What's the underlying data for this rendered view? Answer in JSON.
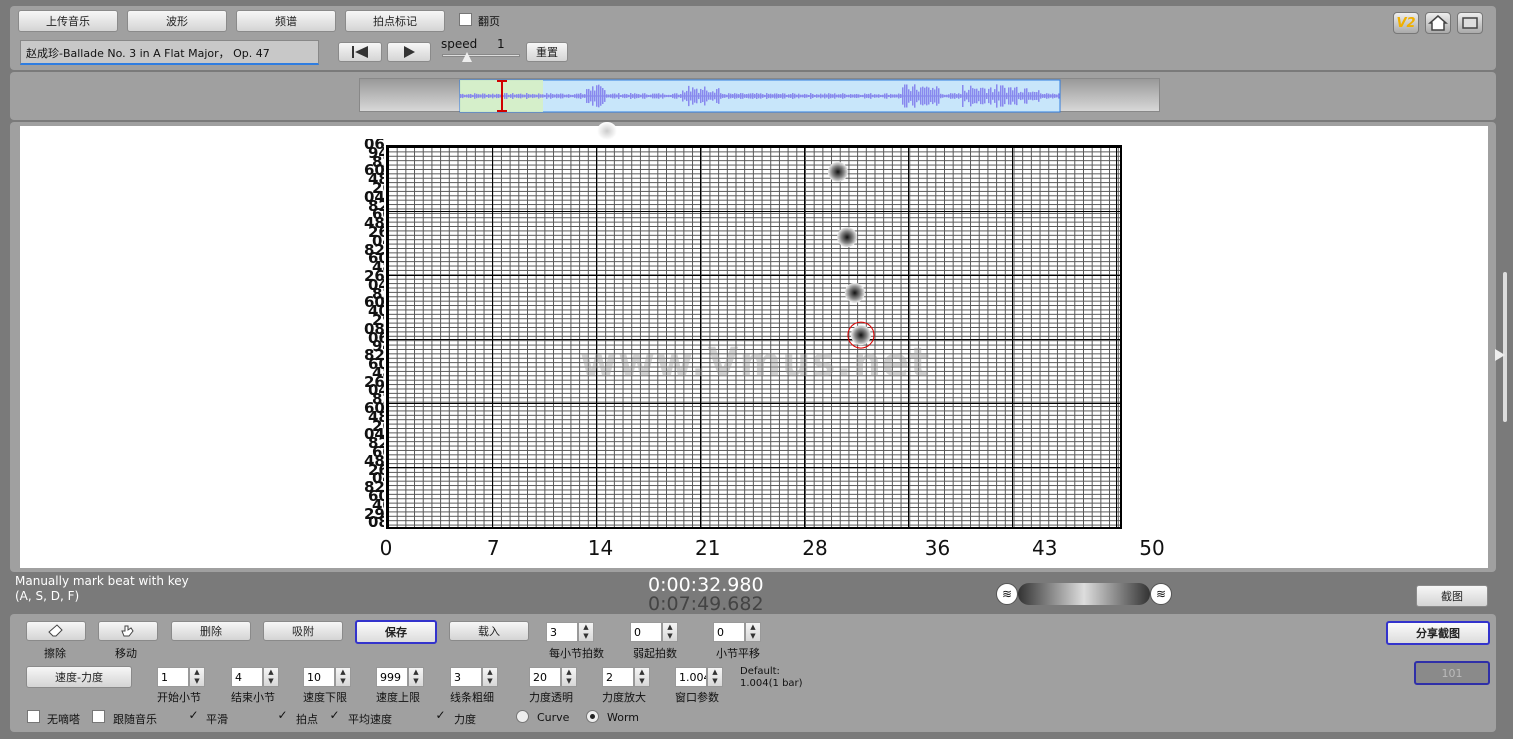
{
  "toolbar": {
    "upload_label": "上传音乐",
    "waveform_label": "波形",
    "spectrum_label": "频谱",
    "beat_mark_label": "拍点标记",
    "flip_page_label": "翻页"
  },
  "song": {
    "title": "赵成珍-Ballade No. 3 in A Flat Major， Op. 47"
  },
  "playback": {
    "speed_label": "speed",
    "speed_value": "1",
    "reset_label": "重置"
  },
  "top_right": {
    "v2_label": "V2"
  },
  "chart": {
    "x_ticks": [
      "0",
      "7",
      "14",
      "21",
      "28",
      "36",
      "43",
      "50"
    ],
    "watermark": "www.Vmus.net"
  },
  "chart_data": {
    "type": "scatter",
    "x_ticks": [
      0,
      7,
      14,
      21,
      28,
      36,
      43,
      50
    ],
    "xlim": [
      0,
      50
    ],
    "points": [
      {
        "x": 29.5,
        "y_frac": 0.93
      },
      {
        "x": 30.1,
        "y_frac": 0.76
      },
      {
        "x": 30.6,
        "y_frac": 0.615
      },
      {
        "x": 31.0,
        "y_frac": 0.505,
        "highlighted": true
      }
    ],
    "grid": true
  },
  "status": {
    "hint_line1": "Manually mark beat with key",
    "hint_line2": "(A, S, D, F)",
    "current_time": "0:00:32.980",
    "total_time": "0:07:49.682",
    "screenshot_label": "截图"
  },
  "tools": {
    "erase_label": "擦除",
    "move_label": "移动",
    "delete_label": "删除",
    "snap_label": "吸附",
    "save_label": "保存",
    "load_label": "载入",
    "share_screenshot_label": "分享截图",
    "disabled_label": "101",
    "speed_dynamics_label": "速度-力度"
  },
  "params_row1": [
    {
      "label": "每小节拍数",
      "value": "3"
    },
    {
      "label": "弱起拍数",
      "value": "0"
    },
    {
      "label": "小节平移",
      "value": "0"
    }
  ],
  "params_row2": [
    {
      "label": "开始小节",
      "value": "1"
    },
    {
      "label": "结束小节",
      "value": "4"
    },
    {
      "label": "速度下限",
      "value": "10"
    },
    {
      "label": "速度上限",
      "value": "999"
    },
    {
      "label": "线条粗细",
      "value": "3"
    },
    {
      "label": "力度透明",
      "value": "20"
    },
    {
      "label": "力度放大",
      "value": "2"
    },
    {
      "label": "窗口参数",
      "value": "1.004"
    }
  ],
  "default_note": {
    "line1": "Default:",
    "line2": "1.004(1 bar)"
  },
  "options": {
    "metronome_label": "无嘀嗒",
    "follow_music_label": "跟随音乐",
    "smooth_label": "平滑",
    "beat_point_label": "拍点",
    "avg_speed_label": "平均速度",
    "dynamics_label": "力度",
    "curve_label": "Curve",
    "worm_label": "Worm"
  },
  "colors": {
    "panel": "#a0a0a0",
    "background": "#7a7a7a",
    "accent_blue": "#3333cc",
    "waveform": "#8888ee",
    "selection": "#c8e6fa"
  }
}
